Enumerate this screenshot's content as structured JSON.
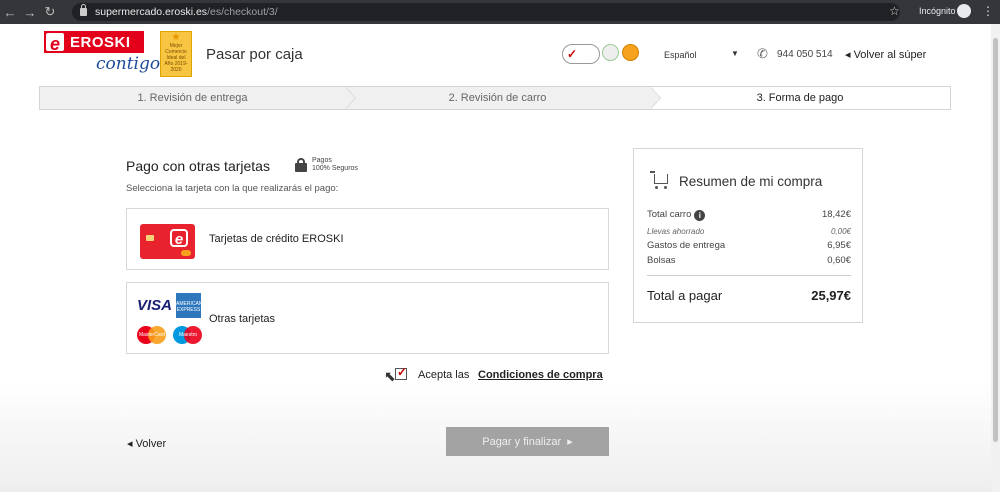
{
  "browser": {
    "url_domain": "supermercado.eroski.es",
    "url_path": "/es/checkout/3/",
    "mode_label": "Incógnito"
  },
  "header": {
    "logo_text": "EROSKI",
    "logo_tagline": "contigo",
    "award_text": "Mejor Comercio Ideal del Año 2019-2020",
    "page_title": "Pasar por caja",
    "language": "Español",
    "phone": "944 050 514",
    "back_to_store": "Volver al súper"
  },
  "steps": [
    {
      "label": "1. Revisión de entrega",
      "state": "done"
    },
    {
      "label": "2. Revisión de carro",
      "state": "done"
    },
    {
      "label": "3. Forma de pago",
      "state": "current"
    }
  ],
  "payment": {
    "title": "Pago con otras tarjetas",
    "secure_line1": "Pagos",
    "secure_line2": "100% Seguros",
    "subtitle": "Selecciona la tarjeta con la que realizarás el pago:",
    "options": [
      {
        "label": "Tarjetas de crédito EROSKI"
      },
      {
        "label": "Otras tarjetas"
      }
    ],
    "card_logos": {
      "visa": "VISA",
      "amex": "AMERICAN EXPRESS",
      "mastercard": "MasterCard",
      "maestro": "Maestro"
    },
    "accept_prefix": "Acepta las",
    "accept_link": "Condiciones de compra",
    "accept_checked": true,
    "back_label": "Volver",
    "finish_label": "Pagar y finalizar"
  },
  "summary": {
    "title": "Resumen de mi compra",
    "rows": [
      {
        "label": "Total carro",
        "value": "18,42€",
        "info": true
      },
      {
        "label": "Llevas ahorrado",
        "value": "0,00€",
        "italic": true
      },
      {
        "label": "Gastos de entrega",
        "value": "6,95€"
      },
      {
        "label": "Bolsas",
        "value": "0,60€"
      }
    ],
    "total_label": "Total a pagar",
    "total_value": "25,97€"
  },
  "colors": {
    "brand_red": "#e2001a",
    "brand_blue": "#1e4a9a",
    "button_disabled": "#a3a3a3"
  }
}
